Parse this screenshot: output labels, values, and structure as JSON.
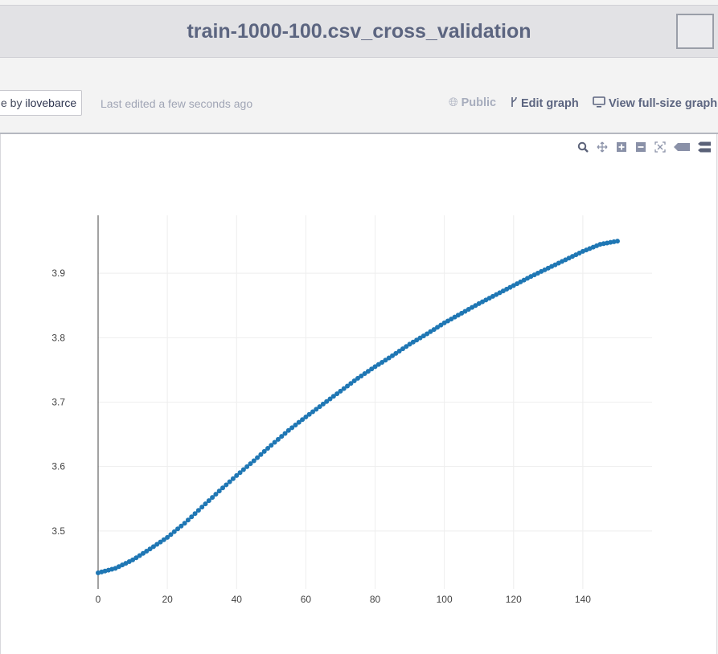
{
  "header": {
    "title": "train-1000-100.csv_cross_validation"
  },
  "subbar": {
    "author_prefix": "e by ",
    "author_name": "ilovebarce",
    "edited": "Last edited a few seconds ago",
    "public_label": "Public",
    "edit_label": "Edit graph",
    "view_label": "View full-size graph"
  },
  "icons": {
    "public": "globe-icon",
    "edit": "fork-icon",
    "view": "monitor-icon",
    "zoom": "zoom-icon",
    "pan": "pan-icon",
    "zoom_in": "zoom-in-icon",
    "zoom_out": "zoom-out-icon",
    "autoscale": "autoscale-icon",
    "hover_closest": "hover-closest-icon",
    "hover_compare": "hover-compare-icon"
  },
  "colors": {
    "series": "#1f77b4",
    "title": "#5c6580",
    "grid": "#eeeeee"
  },
  "chart_data": {
    "type": "scatter",
    "mode": "lines+markers",
    "title": "",
    "xlabel": "",
    "ylabel": "",
    "xlim": [
      0,
      160
    ],
    "ylim": [
      3.41,
      3.99
    ],
    "x_ticks": [
      0,
      20,
      40,
      60,
      80,
      100,
      120,
      140
    ],
    "y_ticks": [
      3.5,
      3.6,
      3.7,
      3.8,
      3.9
    ],
    "grid": true,
    "x": [
      0,
      5,
      10,
      15,
      20,
      25,
      30,
      35,
      40,
      45,
      50,
      55,
      60,
      65,
      70,
      75,
      80,
      85,
      90,
      95,
      100,
      105,
      110,
      115,
      120,
      125,
      130,
      135,
      140,
      145,
      150
    ],
    "y": [
      3.435,
      3.442,
      3.455,
      3.472,
      3.49,
      3.512,
      3.537,
      3.562,
      3.586,
      3.609,
      3.633,
      3.656,
      3.677,
      3.697,
      3.717,
      3.737,
      3.755,
      3.772,
      3.79,
      3.806,
      3.823,
      3.838,
      3.853,
      3.867,
      3.881,
      3.895,
      3.908,
      3.921,
      3.934,
      3.945,
      3.95
    ],
    "points_per_segment": 5
  }
}
